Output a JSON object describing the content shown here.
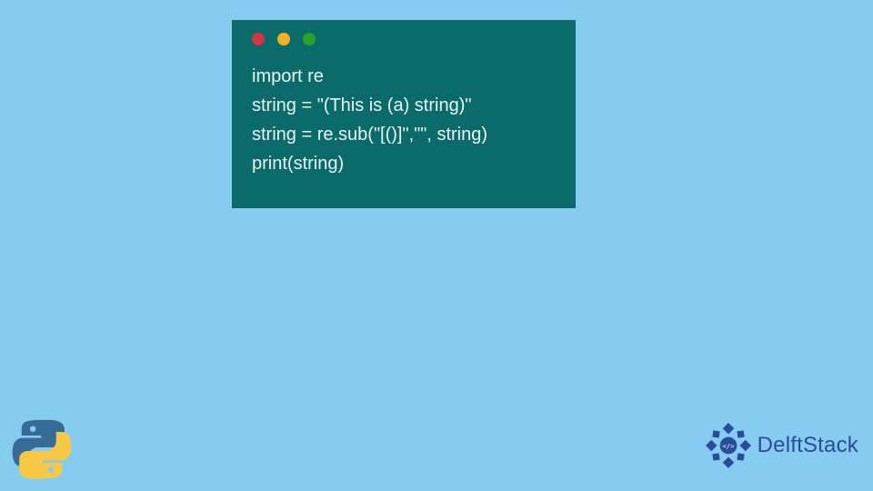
{
  "window": {
    "traffic_lights": [
      "red",
      "yellow",
      "green"
    ]
  },
  "code": {
    "lines": [
      "import re",
      "string = \"(This is (a) string)\"",
      "string = re.sub(\"[()]\",\"\", string)",
      "print(string)"
    ]
  },
  "logos": {
    "python_icon": "python-icon",
    "delftstack_icon": "delftstack-icon",
    "delftstack_label": "DelftStack"
  },
  "colors": {
    "background": "#86ccf1",
    "window_bg": "#0b6a6a",
    "code_text": "#e9f4f4",
    "brand_blue": "#2a4d9b"
  }
}
